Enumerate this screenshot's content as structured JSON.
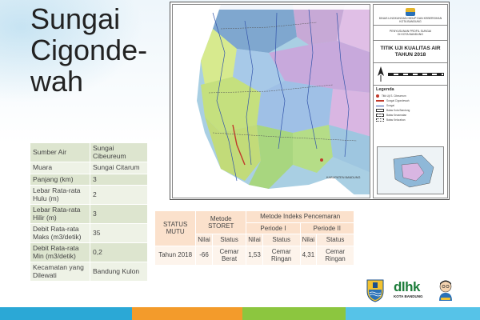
{
  "title": [
    "Sungai",
    "Cigonde-",
    "wah"
  ],
  "info_table": [
    {
      "key": "Sumber Air",
      "value": "Sungai Cibeureum"
    },
    {
      "key": "Muara",
      "value": "Sungai Citarum"
    },
    {
      "key": "Panjang (km)",
      "value": "3"
    },
    {
      "key": "Lebar Rata-rata Hulu (m)",
      "value": "2"
    },
    {
      "key": "Lebar Rata-rata Hilir (m)",
      "value": "3"
    },
    {
      "key": "Debit Rata-rata Maks (m3/detik)",
      "value": "35"
    },
    {
      "key": "Debit Rata-rata Min (m3/detik)",
      "value": "0,2"
    },
    {
      "key": "Kecamatan yang Dilewati",
      "value": "Bandung Kulon"
    }
  ],
  "map": {
    "agency": "DINAS LINGKUNGAN HIDUP DAN KEBERSIHAN",
    "agency_city": "KOTA BANDUNG",
    "project": "PENYUSUNAN PROFIL SUNGAI",
    "project_city": "DI KOTA BANDUNG",
    "map_title": "TITIK UJI KUALITAS AIR",
    "map_year": "TAHUN 2018",
    "legend_title": "Legenda",
    "district_label": "KABUPATEN BANDUNG",
    "legend_items": [
      "Titik Uji S. Cibeureum",
      "Sungai Cigondewah",
      "Sungai",
      "Batas Kota Bandung",
      "Batas Kecamatan",
      "Batas Kelurahan"
    ]
  },
  "status_table": {
    "h_status": "STATUS MUTU",
    "h_storet": "Metode STORET",
    "h_ip": "Metode Indeks Pencemaran",
    "h_p1": "Periode I",
    "h_p2": "Periode II",
    "h_nilai": "Nilai",
    "h_status_col": "Status",
    "row_label": "Tahun 2018",
    "storet_nilai": "-66",
    "storet_status": "Cemar Berat",
    "p1_nilai": "1,53",
    "p1_status": "Cemar Ringan",
    "p2_nilai": "4,31",
    "p2_status": "Cemar Ringan"
  },
  "logos": {
    "dlhk": "dlhk",
    "dlhk_sub": "KOTA BANDUNG"
  },
  "colors": {
    "stripe_blue": "#2ba8d6",
    "stripe_orange": "#f39b2b",
    "stripe_green": "#8cc63f",
    "stripe_sky": "#56c3e8"
  }
}
